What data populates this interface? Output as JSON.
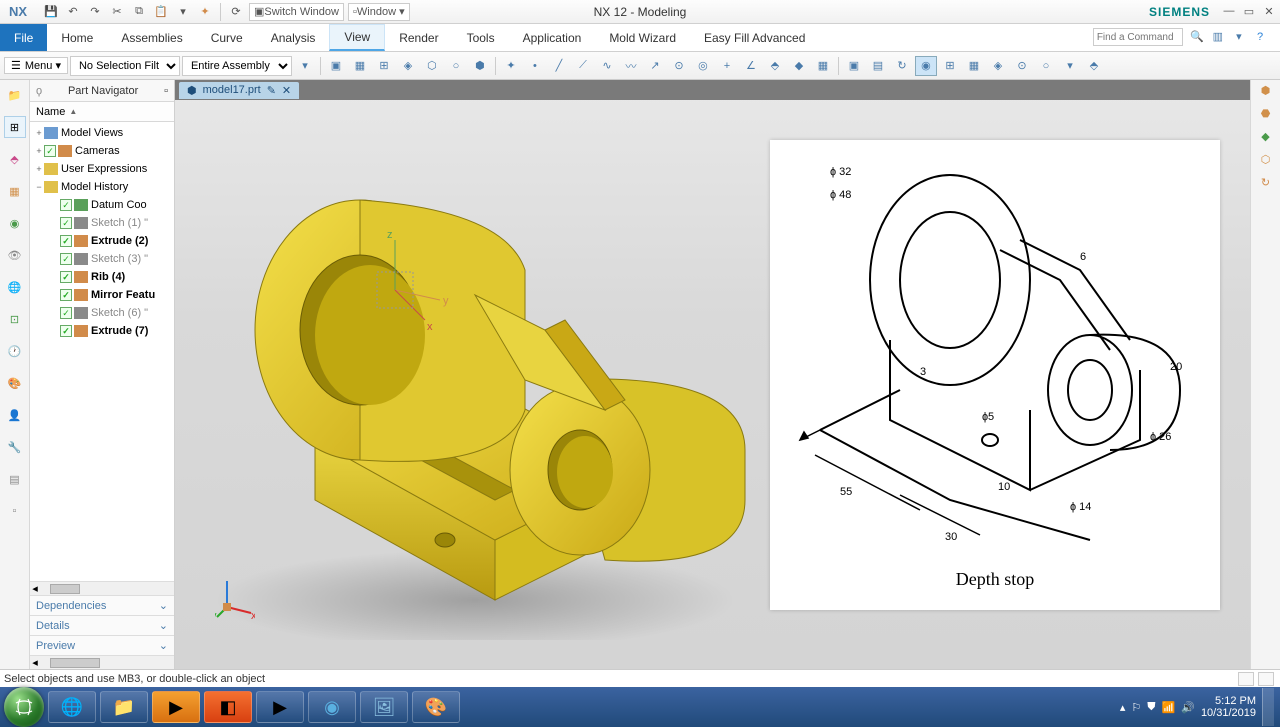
{
  "title_bar": {
    "app": "NX",
    "switch_window": "Switch Window",
    "window_menu": "Window ▾",
    "title": "NX 12 - Modeling",
    "brand": "SIEMENS"
  },
  "ribbon": {
    "file": "File",
    "tabs": [
      "Home",
      "Assemblies",
      "Curve",
      "Analysis",
      "View",
      "Render",
      "Tools",
      "Application",
      "Mold Wizard",
      "Easy Fill Advanced"
    ],
    "active_tab": "View",
    "find_placeholder": "Find a Command"
  },
  "toolbar": {
    "menu_label": "Menu ▾",
    "selection_filter": "No Selection Filter",
    "assembly_filter": "Entire Assembly"
  },
  "navigator": {
    "title": "Part Navigator",
    "column": "Name",
    "tree": [
      {
        "expand": "+",
        "label": "Model Views",
        "icon": "#6b9bd1"
      },
      {
        "expand": "+",
        "check": true,
        "label": "Cameras",
        "icon": "#d18b4a"
      },
      {
        "expand": "+",
        "label": "User Expressions",
        "icon": "#e0c04a"
      },
      {
        "expand": "−",
        "label": "Model History",
        "icon": "#e0c04a"
      },
      {
        "indent": 1,
        "check": true,
        "label": "Datum Coo",
        "icon": "#5aa05a"
      },
      {
        "indent": 1,
        "check": true,
        "label": "Sketch (1) \"",
        "icon": "#8a8a8a",
        "gray": true
      },
      {
        "indent": 1,
        "check": true,
        "label": "Extrude (2)",
        "icon": "#d18b4a",
        "bold": true
      },
      {
        "indent": 1,
        "check": true,
        "label": "Sketch (3) \"",
        "icon": "#8a8a8a",
        "gray": true
      },
      {
        "indent": 1,
        "check": true,
        "label": "Rib (4)",
        "icon": "#d18b4a",
        "bold": true
      },
      {
        "indent": 1,
        "check": true,
        "label": "Mirror Featu",
        "icon": "#d18b4a",
        "bold": true
      },
      {
        "indent": 1,
        "check": true,
        "label": "Sketch (6) \"",
        "icon": "#8a8a8a",
        "gray": true
      },
      {
        "indent": 1,
        "check": true,
        "label": "Extrude (7)",
        "icon": "#d18b4a",
        "bold": true
      }
    ],
    "sections": [
      "Dependencies",
      "Details",
      "Preview"
    ]
  },
  "open_file": "model17.prt",
  "reference": {
    "caption": "Depth stop",
    "dims": [
      "ɸ 32",
      "ɸ 48",
      "6",
      "3",
      "ɸ5",
      "55",
      "10",
      "30",
      "ɸ 14",
      "ɸ 26",
      "20"
    ]
  },
  "triad_axes": {
    "x": "x",
    "y": "y",
    "z": "z"
  },
  "status": "Select objects and use MB3, or double-click an object",
  "taskbar": {
    "time": "5:12 PM",
    "date": "10/31/2019"
  }
}
